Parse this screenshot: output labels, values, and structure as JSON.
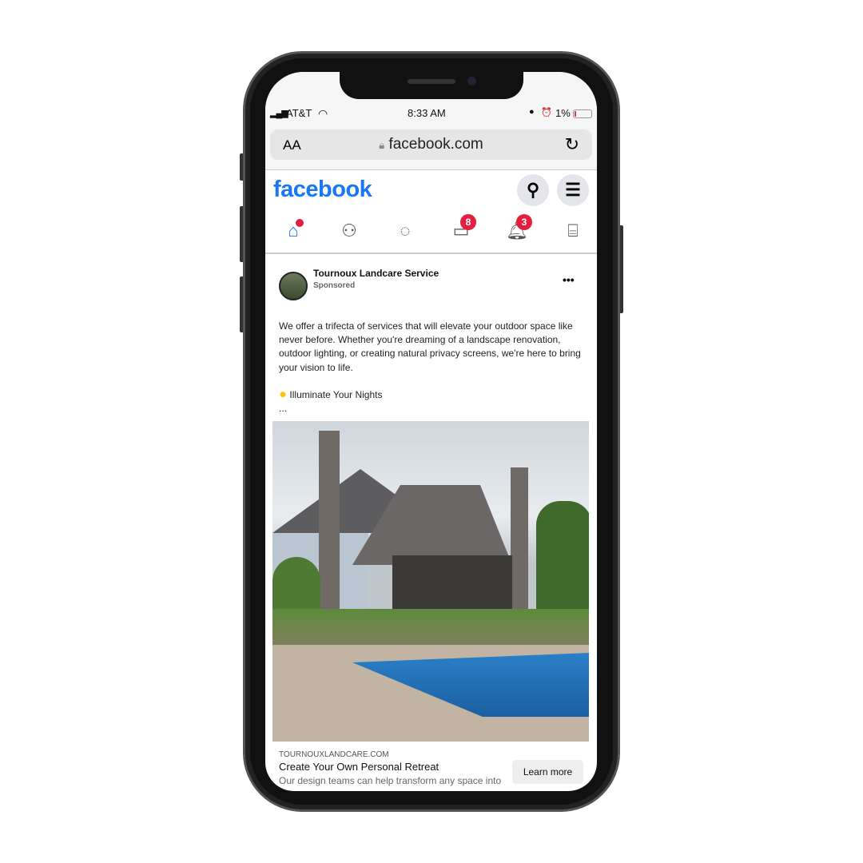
{
  "status": {
    "carrier": "AT&T",
    "time": "8:33 AM",
    "battery": "1%"
  },
  "browser": {
    "text_size": "AA",
    "url": "facebook.com"
  },
  "header": {
    "logo": "facebook",
    "accent": "#1877f2"
  },
  "nav": {
    "items": [
      {
        "name": "home"
      },
      {
        "name": "friends"
      },
      {
        "name": "messenger"
      },
      {
        "name": "watch",
        "badge": "8"
      },
      {
        "name": "notifications",
        "badge": "3"
      },
      {
        "name": "marketplace"
      }
    ]
  },
  "post": {
    "author": "Tournoux Landcare Service",
    "label": "Sponsored",
    "text": "We offer a trifecta of services that will elevate your outdoor space like never before. Whether you're dreaming of a landscape renovation, outdoor lighting, or creating natural privacy screens, we're here to bring your vision to life.",
    "highlight": "Illuminate Your Nights",
    "ellipsis": "...",
    "link_domain": "TOURNOUXLANDCARE.COM",
    "link_title": "Create Your Own Personal Retreat",
    "link_desc": "Our design teams can help transform any space into",
    "cta": "Learn more"
  }
}
